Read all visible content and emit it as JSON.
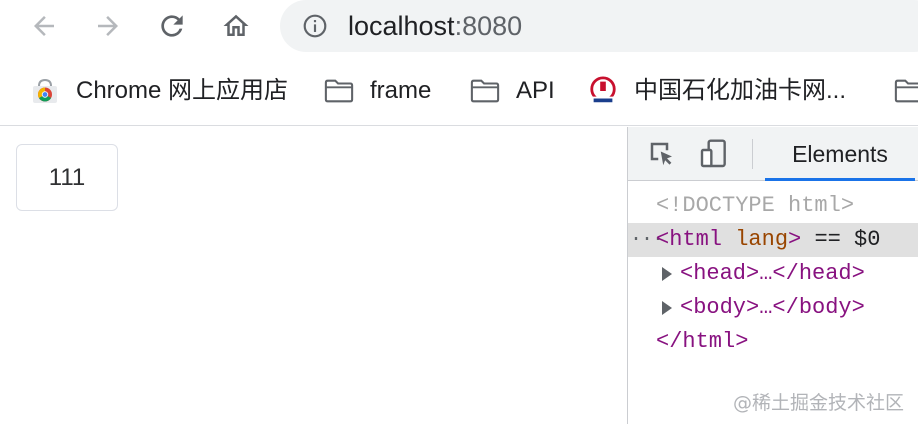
{
  "toolbar": {
    "back_icon": "arrow-left-icon",
    "forward_icon": "arrow-right-icon",
    "reload_icon": "reload-icon",
    "home_icon": "home-icon",
    "info_icon": "info-icon",
    "url_host": "localhost",
    "url_port": ":8080"
  },
  "bookmarks": [
    {
      "label": "Chrome 网上应用店",
      "icon": "chrome-web-store-icon"
    },
    {
      "label": "frame",
      "icon": "folder-icon"
    },
    {
      "label": "API",
      "icon": "folder-icon"
    },
    {
      "label": "中国石化加油卡网...",
      "icon": "sinopec-logo-icon"
    }
  ],
  "page": {
    "button_label": "111"
  },
  "devtools": {
    "inspect_icon": "inspect-element-icon",
    "device_icon": "device-toggle-icon",
    "active_tab": "Elements",
    "dom": {
      "doctype": "<!DOCTYPE html>",
      "ellipsis": "···",
      "html_open_tag": "html",
      "html_attr": "lang",
      "selected_marker": "== $0",
      "head_text": "<head>…</head>",
      "body_text": "<body>…</body>",
      "html_close": "</html>"
    }
  },
  "watermark": "@稀土掘金技术社区",
  "colors": {
    "omnibox_bg": "#f1f3f4",
    "tag": "#881280",
    "attr": "#994500",
    "active_tab_underline": "#1a73e8",
    "selected_row": "#e0e0e0"
  }
}
